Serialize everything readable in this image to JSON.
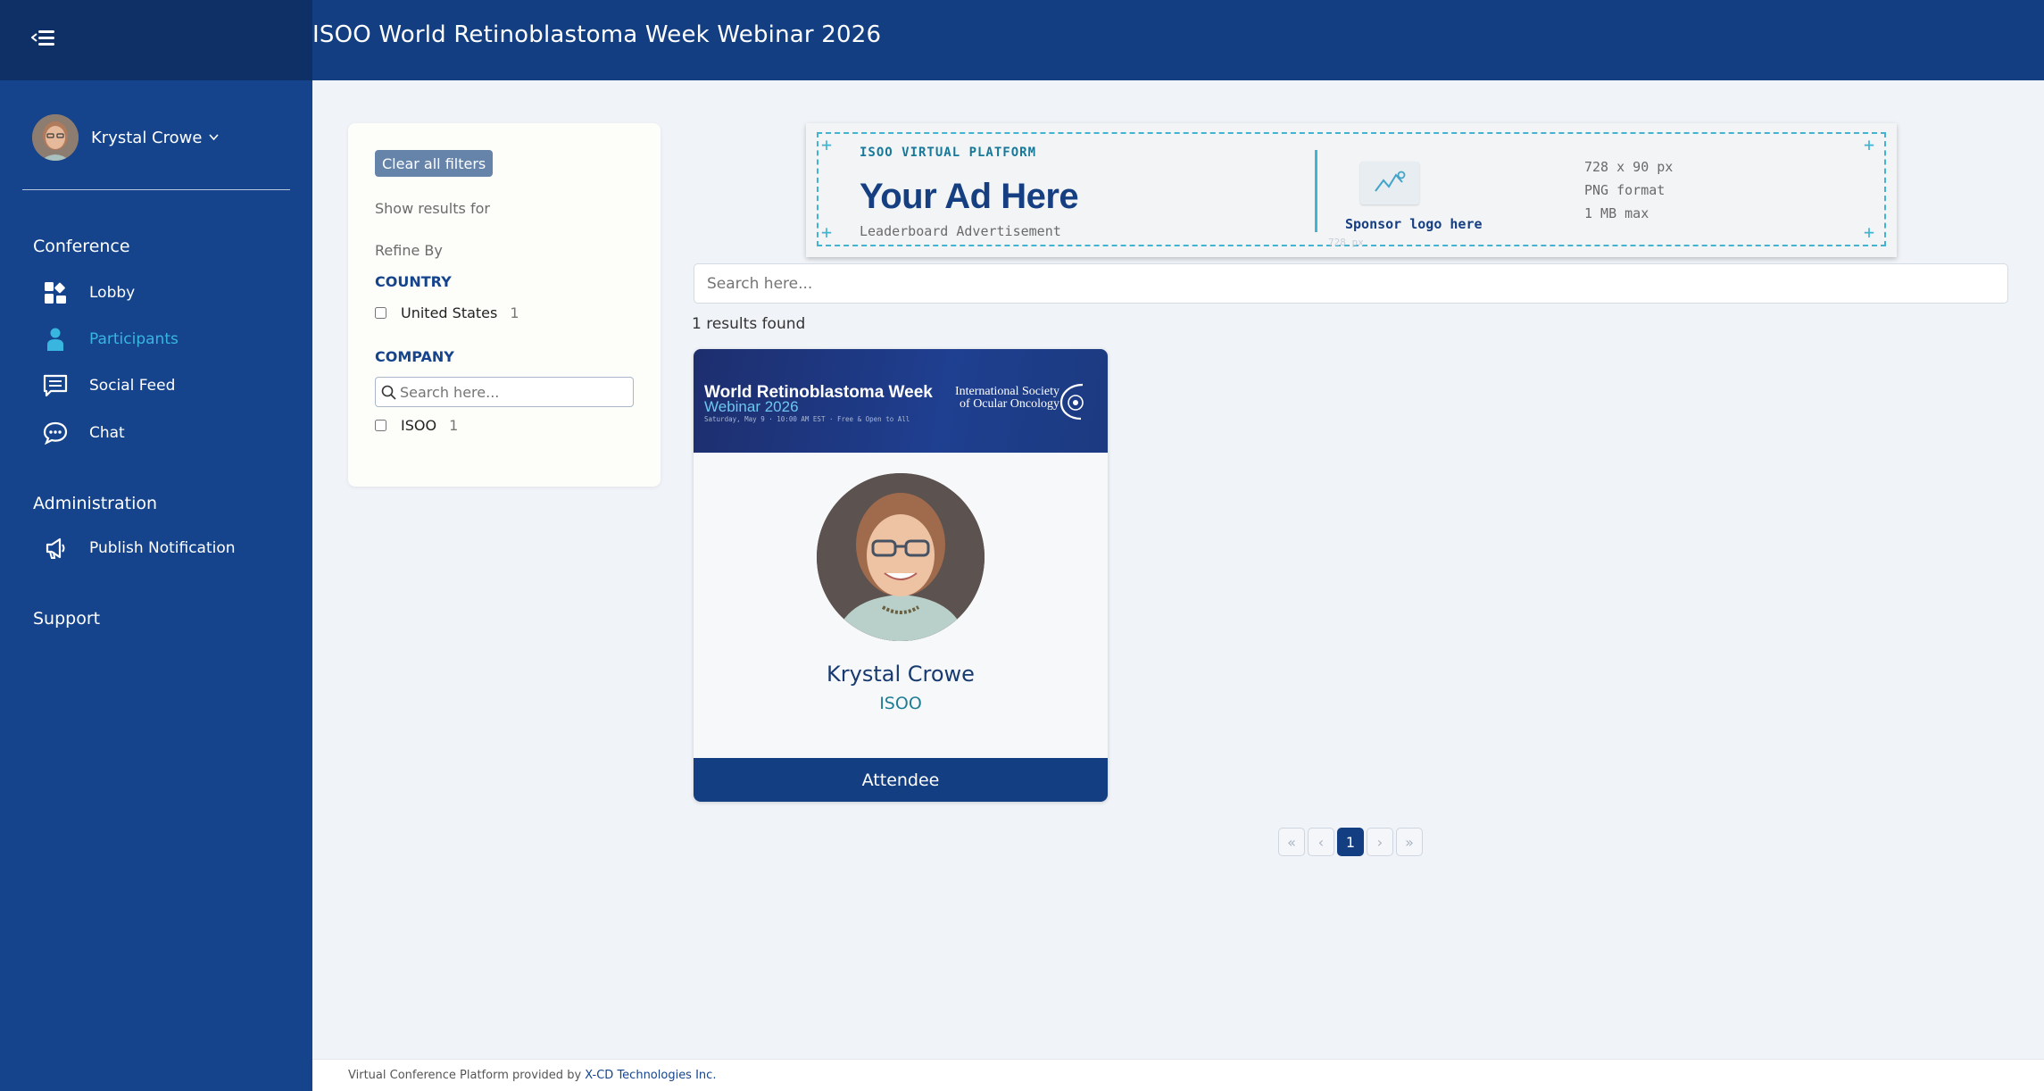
{
  "header": {
    "menu_icon": "hamburger-menu-icon",
    "title": "ISOO World Retinoblastoma Week Webinar 2026"
  },
  "sidebar": {
    "user": {
      "name": "Krystal Crowe",
      "caret_icon": "chevron-down-icon"
    },
    "sections": {
      "conference": "Conference",
      "administration": "Administration",
      "support": "Support"
    },
    "items": [
      {
        "label": "Lobby",
        "icon": "dashboard-icon"
      },
      {
        "label": "Participants",
        "icon": "person-icon",
        "active": true
      },
      {
        "label": "Social Feed",
        "icon": "feed-icon"
      },
      {
        "label": "Chat",
        "icon": "chat-bubble-icon"
      },
      {
        "label": "Publish Notification",
        "icon": "megaphone-icon"
      }
    ],
    "colors": {
      "bg": "#15448c",
      "active": "#38b6e0"
    }
  },
  "filters": {
    "clear_label": "Clear all filters",
    "show_results_for": "Show results for",
    "refine_by": "Refine By",
    "country": {
      "title": "COUNTRY",
      "options": [
        {
          "label": "United States",
          "count": "1",
          "checked": false
        }
      ]
    },
    "company": {
      "title": "COMPANY",
      "search_placeholder": "Search here...",
      "options": [
        {
          "label": "ISOO",
          "count": "1",
          "checked": false
        }
      ]
    }
  },
  "ad": {
    "platform": "ISOO VIRTUAL PLATFORM",
    "headline": "Your Ad Here",
    "subline": "Leaderboard Advertisement",
    "sponsor": "Sponsor logo here",
    "spec1": "728 x 90 px",
    "spec2": "PNG format",
    "spec3": "1 MB max",
    "faint": "728 px"
  },
  "search": {
    "placeholder": "Search here..."
  },
  "results_text": "1 results found",
  "participants": [
    {
      "banner_title": "World Retinoblastoma Week",
      "banner_webinar": "Webinar 2026",
      "banner_date": "Saturday, May 9  ·  10:00 AM EST  ·  Free & Open to All",
      "banner_society_line1": "International Society",
      "banner_society_line2": "of Ocular Oncology",
      "name": "Krystal Crowe",
      "company": "ISOO",
      "role": "Attendee"
    }
  ],
  "pagination": {
    "first": "«",
    "prev": "‹",
    "current": "1",
    "next": "›",
    "last": "»"
  },
  "footer": {
    "text": "Virtual Conference Platform provided by ",
    "link": "X-CD Technologies Inc."
  }
}
